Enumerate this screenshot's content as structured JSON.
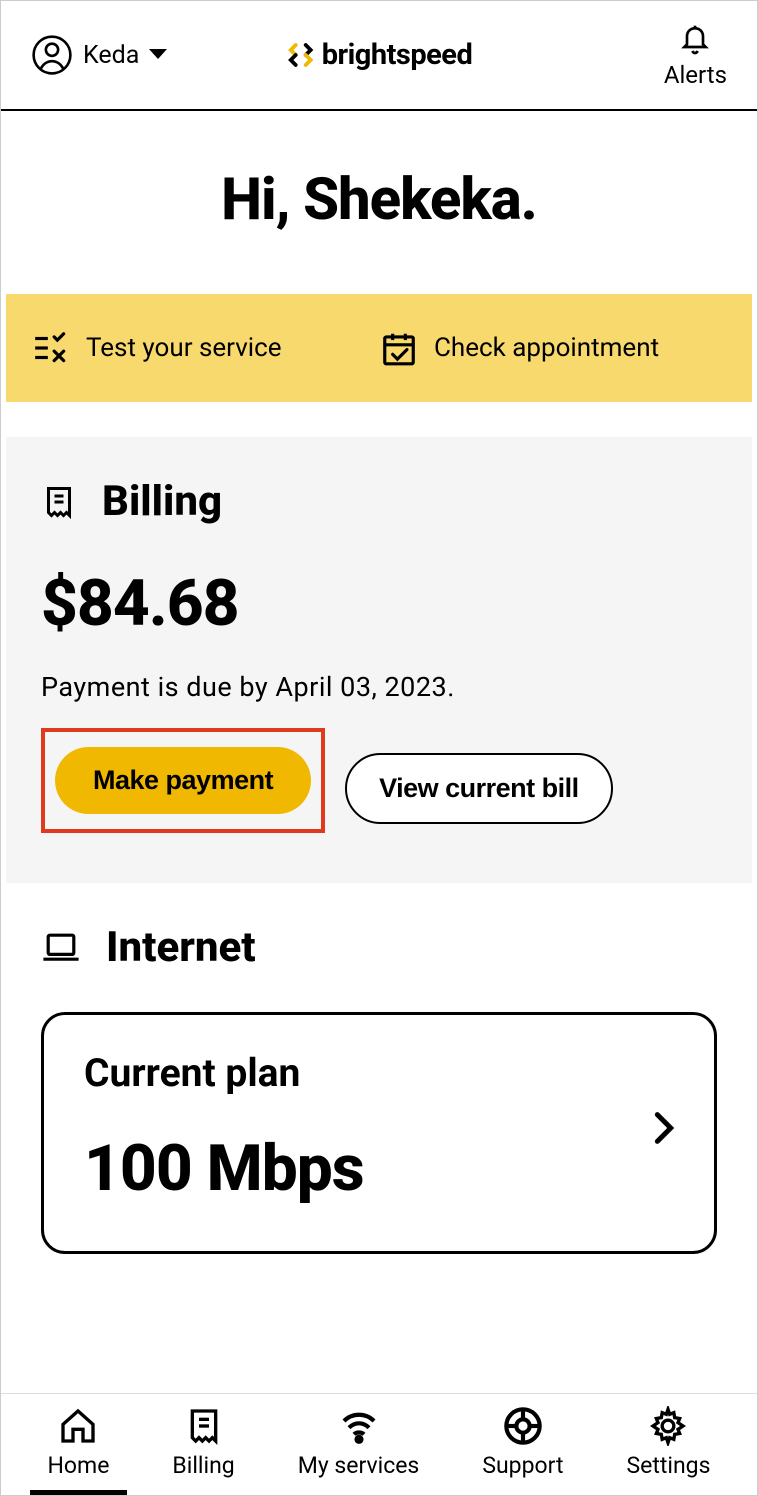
{
  "header": {
    "user_name": "Keda",
    "brand": "brightspeed",
    "alerts_label": "Alerts"
  },
  "greeting": "Hi, Shekeka.",
  "actions": {
    "test_service": "Test your service",
    "check_appointment": "Check appointment"
  },
  "billing": {
    "title": "Billing",
    "amount": "$84.68",
    "due_text": "Payment is due by April 03, 2023.",
    "make_payment": "Make payment",
    "view_bill": "View current bill"
  },
  "internet": {
    "title": "Internet",
    "plan_label": "Current plan",
    "plan_value": "100 Mbps"
  },
  "nav": {
    "home": "Home",
    "billing": "Billing",
    "services": "My services",
    "support": "Support",
    "settings": "Settings"
  }
}
